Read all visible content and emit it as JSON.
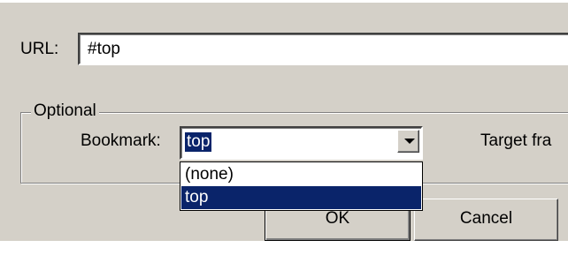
{
  "form": {
    "url_label": "URL:",
    "url_value": "#top",
    "optional_legend": "Optional",
    "bookmark_label": "Bookmark:",
    "bookmark_value": "top",
    "bookmark_options": [
      "(none)",
      "top"
    ],
    "bookmark_selected_index": 1,
    "target_frame_label": "Target fra"
  },
  "buttons": {
    "ok_label": "OK",
    "cancel_label": "Cancel"
  },
  "colors": {
    "dialog_bg": "#d4d0c8",
    "selection_bg": "#0a246a",
    "selection_text": "#ffffff"
  }
}
